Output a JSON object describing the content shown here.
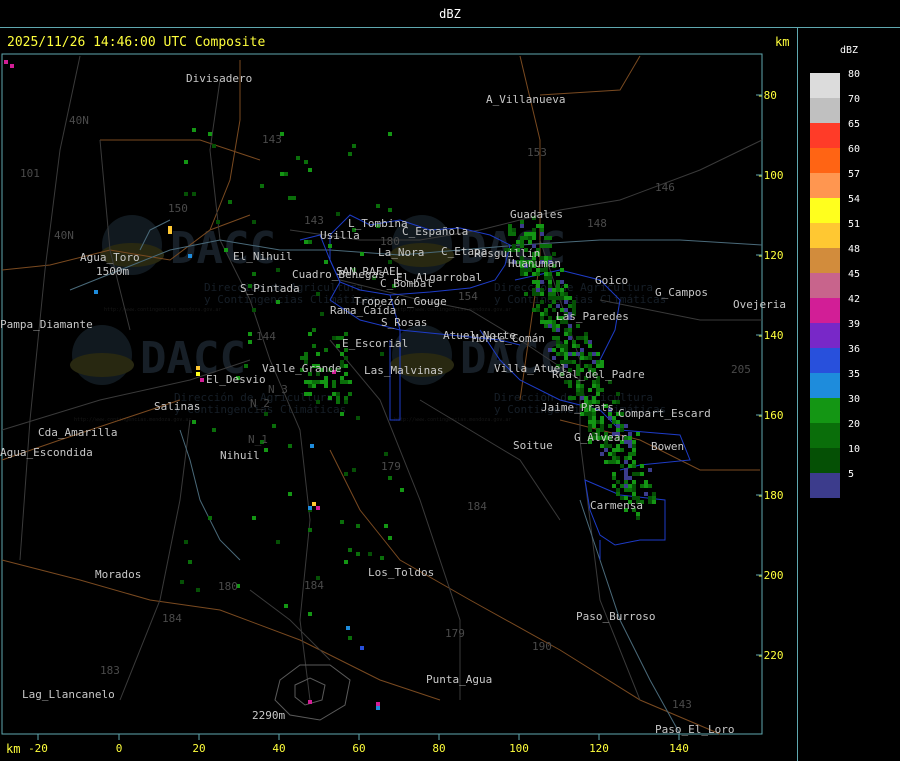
{
  "header": {
    "title": "dBZ"
  },
  "map": {
    "timestamp": "2025/11/26 14:46:00 UTC Composite",
    "unit_top": "km",
    "unit_bottom": "km",
    "x_ticks": [
      "-20",
      "0",
      "20",
      "40",
      "60",
      "80",
      "100",
      "120",
      "140"
    ],
    "y_ticks": [
      "-80",
      "-100",
      "-120",
      "-140",
      "-160",
      "-180",
      "-200",
      "-220"
    ],
    "road_numbers": [
      "143",
      "153",
      "146",
      "148",
      "150",
      "40N",
      "40N",
      "101",
      "143",
      "144",
      "184",
      "179",
      "180",
      "184",
      "184",
      "183",
      "179",
      "180",
      "190",
      "143",
      "205",
      "154",
      "N_2",
      "N_3",
      "N_1"
    ],
    "places": [
      "Divisadero",
      "A_Villanueva",
      "L_Tombina",
      "C_Española",
      "Usilla",
      "La_Nora",
      "Agua_Toro",
      "Guadales",
      "C_Etapa",
      "Resguillín",
      "Huanuman",
      "Goico",
      "G_Campos",
      "Ovejeria",
      "Cuadro_Benegas",
      "SAN_RAFAEL",
      "C_Bombal",
      "El_Algarrobal",
      "Tropezón_Gouge",
      "El_Nihuil",
      "Rama_Caída",
      "Las_Paredes",
      "Villa_Atuel",
      "Real_del_Padre",
      "Jaime_Prats",
      "S_Pintada",
      "Las_Malvinas",
      "El_Desvio",
      "Salinas",
      "Valle_Grande",
      "E_Escorial",
      "Atuel_Norte",
      "S_Rosas",
      "Monte_Comán",
      "Compart_Escard",
      "Bowen",
      "G_Alvear",
      "Soitue",
      "Carmensa",
      "Los_Toldos",
      "Morados",
      "Pampa_Diamante",
      "Lag_Llancanelo",
      "Punta_Agua",
      "Paso_Burroso",
      "Paso_El_Loro",
      "Cda_Amarilla",
      "Agua_Escondida",
      "Nihuil",
      "2290m",
      "1500m"
    ],
    "map_labels": [
      "Divisadero",
      "A_Villanueva",
      "L_Tombina",
      "C_Española",
      "Usilla",
      "La_Nora",
      "Agua_Toro",
      "Guadales",
      "C_Etapa",
      "Resguillín",
      "Huanuman",
      "Goico",
      "G_Campos",
      "Ovejeria",
      "Cuadro_Benegas",
      "SAN_RAFAEL",
      "C_Bombal",
      "El_Algarrobal",
      "Tropezón_Gouge",
      "El_Nihuil",
      "Rama_Caída",
      "Las_Paredes",
      "Villa_Atuel",
      "Real_del_Padre",
      "Jaime_Prats",
      "S_Pintada",
      "Las_Malvinas",
      "El_Desvio",
      "Salinas",
      "Valle_Grande",
      "E_Escorial",
      "Atuel_Norte",
      "S_Rosas",
      "Monte_Comán",
      "Compart_Escard",
      "Bowen",
      "G_Alvear",
      "Soitue",
      "Carmensa",
      "Los_Toldos",
      "Morados",
      "Pampa_Diamante",
      "Lag_Llancanelo",
      "Punta_Agua",
      "Paso_Burroso",
      "Paso_El_Loro",
      "Cda_Amarilla",
      "Agua_Escondida",
      "Nihuil",
      "2290m",
      "1500m"
    ],
    "labels": [
      "Divisadero",
      "A_Villanueva",
      "L_Tombina",
      "C_Española",
      "Usilla",
      "La_Nora",
      "Agua_Toro",
      "Guadales",
      "C_Etapa",
      "Resguillín",
      "Huanuman",
      "Goico",
      "G_Campos",
      "Ovejeria",
      "Cuadro_Benegas",
      "SAN_RAFAEL",
      "C_Bombal",
      "El_Algarrobal",
      "Tropezón_Gouge",
      "El_Nihuil",
      "Rama_Caída",
      "Las_Paredes",
      "Villa_Atuel",
      "Real_del_Padre",
      "Jaime_Prats",
      "S_Pintada",
      "Las_Malvinas",
      "El_Desvio",
      "Salinas",
      "Valle_Grande",
      "E_Escorial",
      "Atuel_Norte",
      "S_Rosas",
      "Monte_Comán",
      "Compart_Escard",
      "Bowen",
      "G_Alvear",
      "Soitue",
      "Carmensa",
      "Los_Toldos",
      "Morados",
      "Pampa_Diamante",
      "Lag_Llancanelo",
      "Punta_Agua",
      "Paso_Burroso",
      "Paso_El_Loro",
      "Cda_Amarilla",
      "Agua_Escondida",
      "Nihuil",
      "2290m",
      "1500m"
    ],
    "watermark": {
      "logo": "DACC",
      "line1": "Dirección de Agricultura",
      "line2": "y Contingencias Climáticas",
      "url": "http://www.contingencias.mendoza.gov.ar"
    }
  },
  "legend": {
    "title": "dBZ",
    "levels": [
      {
        "label": "80",
        "color": "#dcdcdc"
      },
      {
        "label": "70",
        "color": "#c0c0c0"
      },
      {
        "label": "65",
        "color": "#ff3b28"
      },
      {
        "label": "60",
        "color": "#ff6414"
      },
      {
        "label": "57",
        "color": "#ff9650"
      },
      {
        "label": "54",
        "color": "#ffff1e"
      },
      {
        "label": "51",
        "color": "#ffc832"
      },
      {
        "label": "48",
        "color": "#d28c3c"
      },
      {
        "label": "45",
        "color": "#c8648c"
      },
      {
        "label": "42",
        "color": "#d21e96"
      },
      {
        "label": "39",
        "color": "#7828c8"
      },
      {
        "label": "36",
        "color": "#2850dc"
      },
      {
        "label": "35",
        "color": "#1e8cdc"
      },
      {
        "label": "30",
        "color": "#149614"
      },
      {
        "label": "20",
        "color": "#0a6e0a"
      },
      {
        "label": "10",
        "color": "#055005"
      },
      {
        "label": "5",
        "color": "#3c3c8c"
      }
    ]
  }
}
